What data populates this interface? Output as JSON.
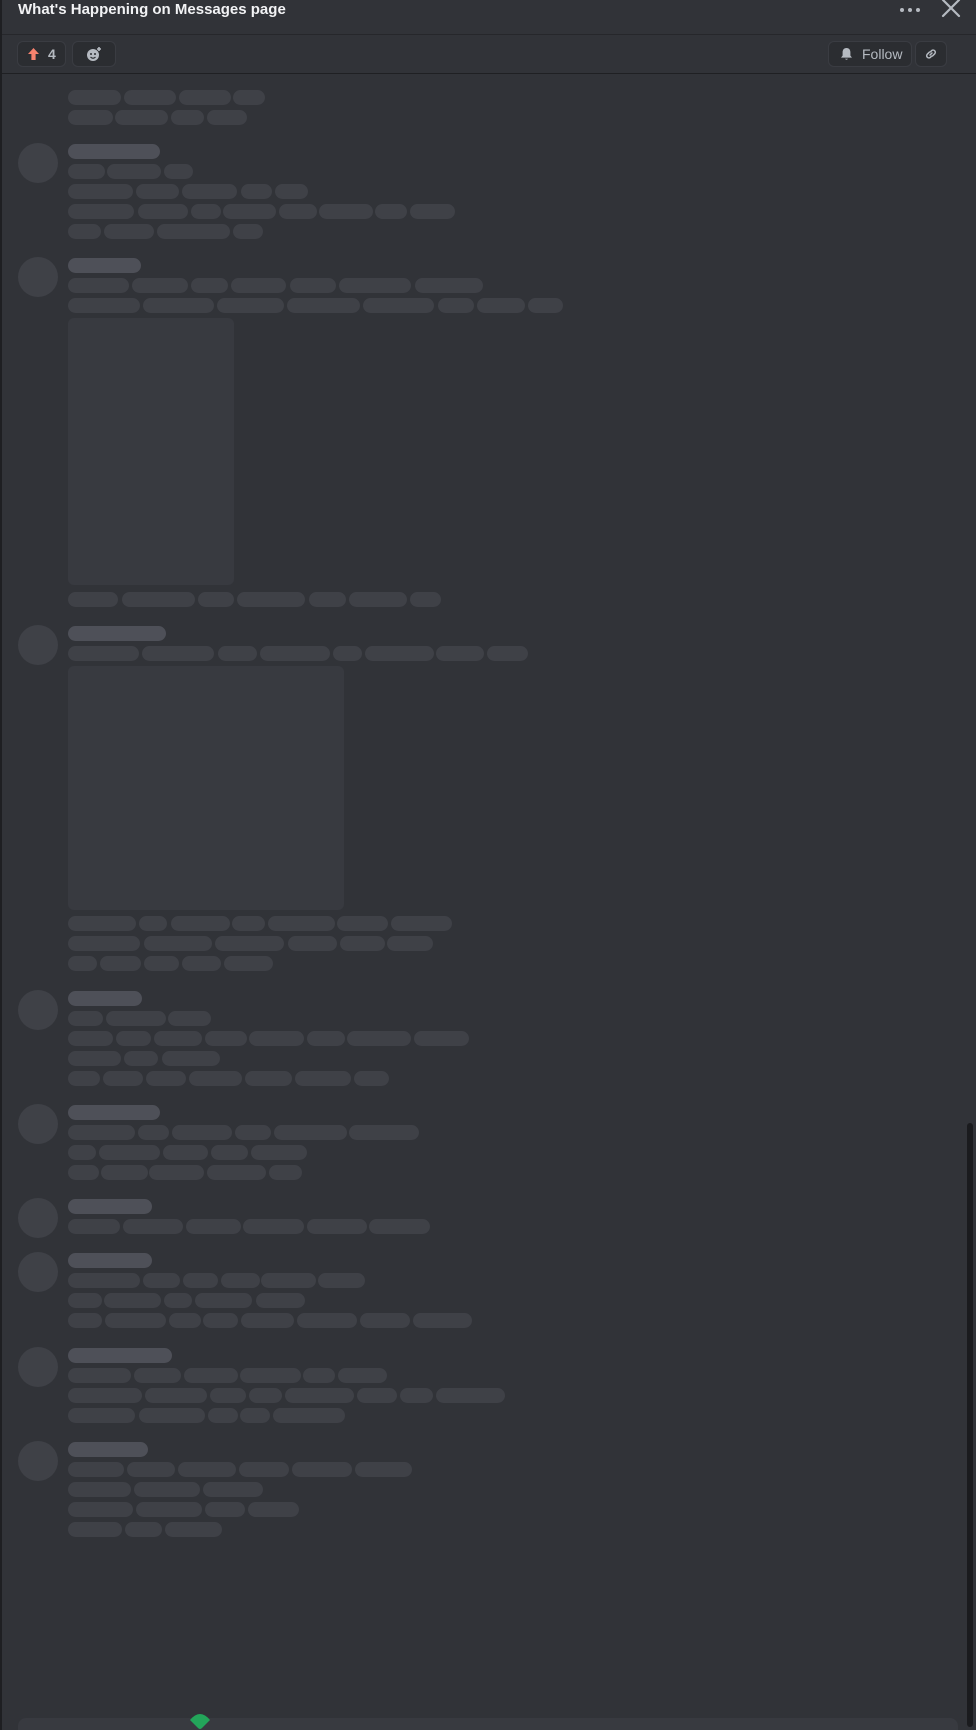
{
  "header": {
    "title": "What's Happening on Messages page",
    "more_icon": "more-horizontal-icon",
    "close_icon": "close-icon"
  },
  "toolbar": {
    "upvote_icon": "arrow-up-icon",
    "upvote_count": "4",
    "upvote_color": "#f7826e",
    "add_reaction_icon": "add-reaction-icon",
    "follow_icon": "bell-icon",
    "follow_label": "Follow",
    "copy_link_icon": "link-icon"
  },
  "messages_state": "loading",
  "colors": {
    "background": "#313338",
    "skeleton": "#3f4147",
    "skeleton_name": "#4e5058",
    "accent_green": "#23a55a"
  }
}
